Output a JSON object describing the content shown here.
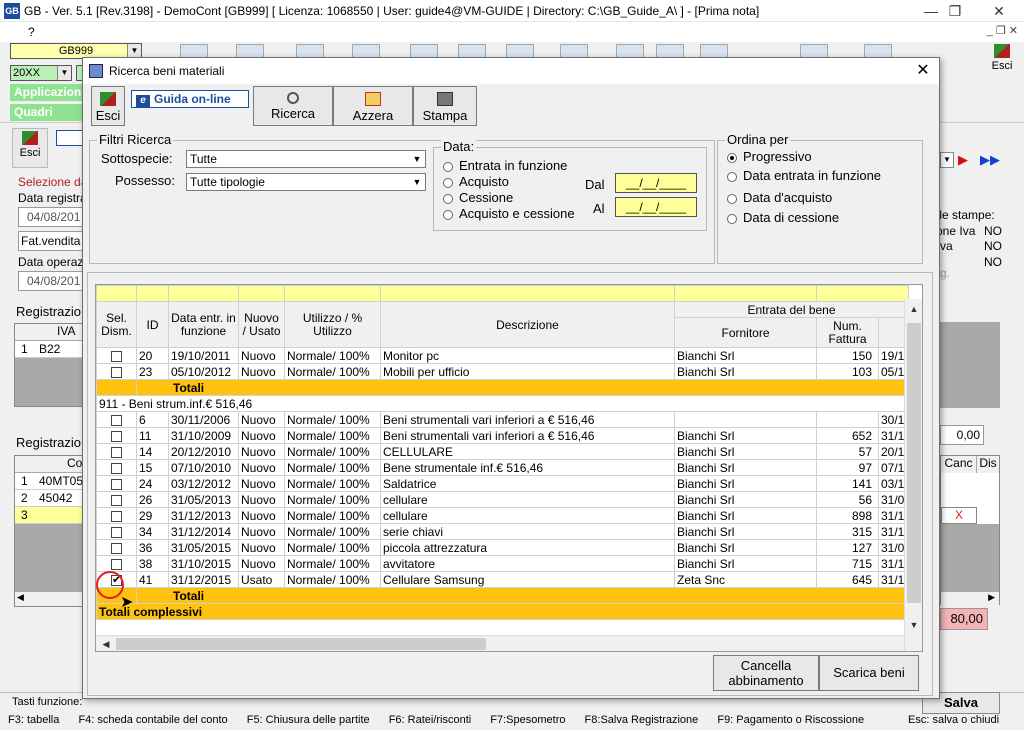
{
  "window": {
    "title": "GB - Ver. 5.1 [Rev.3198] -  DemoCont [GB999]    [ Licenza: 1068550 | User: guide4@VM-GUIDE | Directory: C:\\GB_Guide_A\\ ] - [Prima nota]",
    "logo": "GB",
    "menu_question": "?",
    "minimize": "—",
    "restore": "❐",
    "close": "✕"
  },
  "toolbar": {
    "company": "GB999",
    "year": "20XX",
    "nav_applicazioni": "Applicazion",
    "nav_quadri": "Quadri",
    "esci": "Esci"
  },
  "background": {
    "esci": "Esci",
    "selezione": "Selezione da",
    "data_registrazione_label": "Data registraz",
    "data_registrazione_value": "04/08/201",
    "causale_value": "Fat.vendita",
    "data_operazione_label": "Data operaz",
    "data_operazione_value": "04/08/201",
    "registrazione_iva": "Registrazio",
    "iva_header": "IVA",
    "iva_row_num": "1",
    "iva_row_value": "B22",
    "registrazione_co": "Registrazio",
    "co_header": "Co",
    "co_rows": [
      {
        "n": "1",
        "v": "40MT05"
      },
      {
        "n": "2",
        "v": "45042"
      },
      {
        "n": "3",
        "v": ""
      }
    ],
    "stampe_label": "elle stampe:",
    "stampe_rows": [
      {
        "k": "one Iva",
        "v": "NO"
      },
      {
        "k": "va",
        "v": "NO"
      },
      {
        "k": "g.",
        "v": "NO"
      }
    ],
    "amount_field": "0,00",
    "canc_header": "Canc",
    "dis_header": "Dis",
    "x_mark": "X",
    "total_pink": "80,00",
    "salva": "Salva",
    "tasti_funzione": "Tasti funzione:",
    "fkeys": [
      "F3: tabella",
      "F4: scheda contabile del conto",
      "F5: Chiusura delle partite",
      "F6: Ratei/risconti",
      "F7:Spesometro",
      "F8:Salva Registrazione",
      "F9: Pagamento o Riscossione"
    ],
    "esc_hint": "Esc: salva o chiudi"
  },
  "dialog": {
    "title": "Ricerca beni materiali",
    "close": "✕",
    "esci": "Esci",
    "guida_icon": "e",
    "guida": "Guida on-line",
    "ricerca": "Ricerca",
    "azzera": "Azzera",
    "stampa": "Stampa",
    "filtri": {
      "legend": "Filtri Ricerca",
      "sottospecie_label": "Sottospecie:",
      "sottospecie_value": "Tutte",
      "possesso_label": "Possesso:",
      "possesso_value": "Tutte tipologie"
    },
    "data_group": {
      "legend": "Data:",
      "options": [
        "Entrata in funzione",
        "Acquisto",
        "Cessione",
        "Acquisto e cessione"
      ],
      "dal_label": "Dal",
      "al_label": "Al",
      "dal_value": "__/__/____",
      "al_value": "__/__/____"
    },
    "ordina": {
      "legend": "Ordina per",
      "options": [
        "Progressivo",
        "Data entrata in funzione",
        "Data d'acquisto",
        "Data di cessione"
      ],
      "selected": 0
    },
    "grid": {
      "header_group": "Entrata del bene",
      "headers": {
        "sel": "Sel. Dism.",
        "id": "ID",
        "data": "Data entr. in funzione",
        "nuovo": "Nuovo / Usato",
        "utilizzo": "Utilizzo / % Utilizzo",
        "descrizione": "Descrizione",
        "fornitore": "Fornitore",
        "num": "Num. Fattura"
      },
      "group1_rows": [
        {
          "id": "20",
          "data": "19/10/2011",
          "nuovo": "Nuovo",
          "utilizzo": "Normale/ 100%",
          "descr": "Monitor pc",
          "forn": "Bianchi Srl",
          "num": "150",
          "extra": "19/1",
          "checked": false
        },
        {
          "id": "23",
          "data": "05/10/2012",
          "nuovo": "Nuovo",
          "utilizzo": "Normale/ 100%",
          "descr": "Mobili per ufficio",
          "forn": "Bianchi Srl",
          "num": "103",
          "extra": "05/1",
          "checked": false
        }
      ],
      "totali": "Totali",
      "group2_label": "911 - Beni strum.inf.€ 516,46",
      "group2_rows": [
        {
          "id": "6",
          "data": "30/11/2006",
          "nuovo": "Nuovo",
          "utilizzo": "Normale/ 100%",
          "descr": "Beni strumentali vari inferiori a € 516,46",
          "forn": "",
          "num": "",
          "extra": "30/1",
          "checked": false
        },
        {
          "id": "11",
          "data": "31/10/2009",
          "nuovo": "Nuovo",
          "utilizzo": "Normale/ 100%",
          "descr": "Beni strumentali vari inferiori a € 516,46",
          "forn": "Bianchi Srl",
          "num": "652",
          "extra": "31/1",
          "checked": false
        },
        {
          "id": "14",
          "data": "20/12/2010",
          "nuovo": "Nuovo",
          "utilizzo": "Normale/ 100%",
          "descr": "CELLULARE",
          "forn": "Bianchi Srl",
          "num": "57",
          "extra": "20/1",
          "checked": false
        },
        {
          "id": "15",
          "data": "07/10/2010",
          "nuovo": "Nuovo",
          "utilizzo": "Normale/ 100%",
          "descr": "Bene strumentale inf.€ 516,46",
          "forn": "Bianchi Srl",
          "num": "97",
          "extra": "07/1",
          "checked": false
        },
        {
          "id": "24",
          "data": "03/12/2012",
          "nuovo": "Nuovo",
          "utilizzo": "Normale/ 100%",
          "descr": "Saldatrice",
          "forn": "Bianchi Srl",
          "num": "141",
          "extra": "03/1",
          "checked": false
        },
        {
          "id": "26",
          "data": "31/05/2013",
          "nuovo": "Nuovo",
          "utilizzo": "Normale/ 100%",
          "descr": "cellulare",
          "forn": "Bianchi Srl",
          "num": "56",
          "extra": "31/0",
          "checked": false
        },
        {
          "id": "29",
          "data": "31/12/2013",
          "nuovo": "Nuovo",
          "utilizzo": "Normale/ 100%",
          "descr": "cellulare",
          "forn": "Bianchi Srl",
          "num": "898",
          "extra": "31/1",
          "checked": false
        },
        {
          "id": "34",
          "data": "31/12/2014",
          "nuovo": "Nuovo",
          "utilizzo": "Normale/ 100%",
          "descr": "serie chiavi",
          "forn": "Bianchi Srl",
          "num": "315",
          "extra": "31/1",
          "checked": false
        },
        {
          "id": "36",
          "data": "31/05/2015",
          "nuovo": "Nuovo",
          "utilizzo": "Normale/ 100%",
          "descr": "piccola attrezzatura",
          "forn": "Bianchi Srl",
          "num": "127",
          "extra": "31/0",
          "checked": false
        },
        {
          "id": "38",
          "data": "31/10/2015",
          "nuovo": "Nuovo",
          "utilizzo": "Normale/ 100%",
          "descr": "avvitatore",
          "forn": "Bianchi Srl",
          "num": "715",
          "extra": "31/1",
          "checked": false
        },
        {
          "id": "41",
          "data": "31/12/2015",
          "nuovo": "Usato",
          "utilizzo": "Normale/ 100%",
          "descr": "Cellulare Samsung",
          "forn": "Zeta Snc",
          "num": "645",
          "extra": "31/1",
          "checked": true
        }
      ],
      "totali_complessivi": "Totali complessivi"
    },
    "cancella_abbinamento": "Cancella abbinamento",
    "scarica_beni": "Scarica beni"
  },
  "colors": {
    "total_row": "#ffc20e",
    "header_yellow": "#ffff99",
    "date_field": "#ffff99",
    "nav_green": "#8fe28f"
  }
}
